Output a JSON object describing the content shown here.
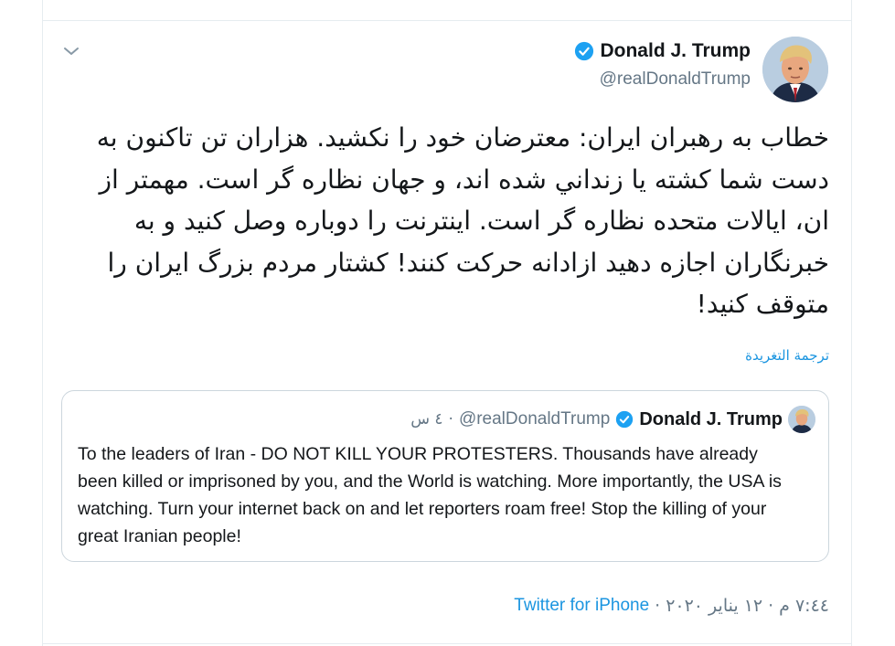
{
  "tweet": {
    "author_name": "Donald J. Trump",
    "author_handle": "@realDonaldTrump",
    "verified_icon": "verified-badge-icon",
    "menu_icon": "chevron-down-icon",
    "text": "خطاب به رهبران ایران: معترضان خود را نکشید. هزاران تن تاکنون به دست شما کشته یا زنداني شده اند، و جهان نظاره گر است. مهمتر از ان، ایالات متحده نظاره گر است. اینترنت را دوباره وصل کنید و به خبرنگاران اجازه دهید ازادانه حرکت کنند! کشتار مردم بزرگ ایران را متوقف کنید!",
    "translate_label": "ترجمة التغريدة",
    "time": "٧:٤٤ م",
    "dot1": "·",
    "date": "١٢ يناير ٢٠٢٠",
    "dot2": "·",
    "source": "Twitter for iPhone"
  },
  "quoted": {
    "author_name": "Donald J. Trump",
    "author_handle": "@realDonaldTrump",
    "dot": "·",
    "time_ago": "٤ س",
    "text": "To the leaders of Iran - DO NOT KILL YOUR PROTESTERS. Thousands have already been killed or imprisoned by you, and the World is watching. More importantly, the USA is watching. Turn your internet back on and let reporters roam free! Stop the killing of your great Iranian people!"
  },
  "colors": {
    "link": "#1b95e0",
    "verified": "#1da1f2",
    "text": "#14171a",
    "secondary": "#657786",
    "border": "#ccd6dd"
  }
}
